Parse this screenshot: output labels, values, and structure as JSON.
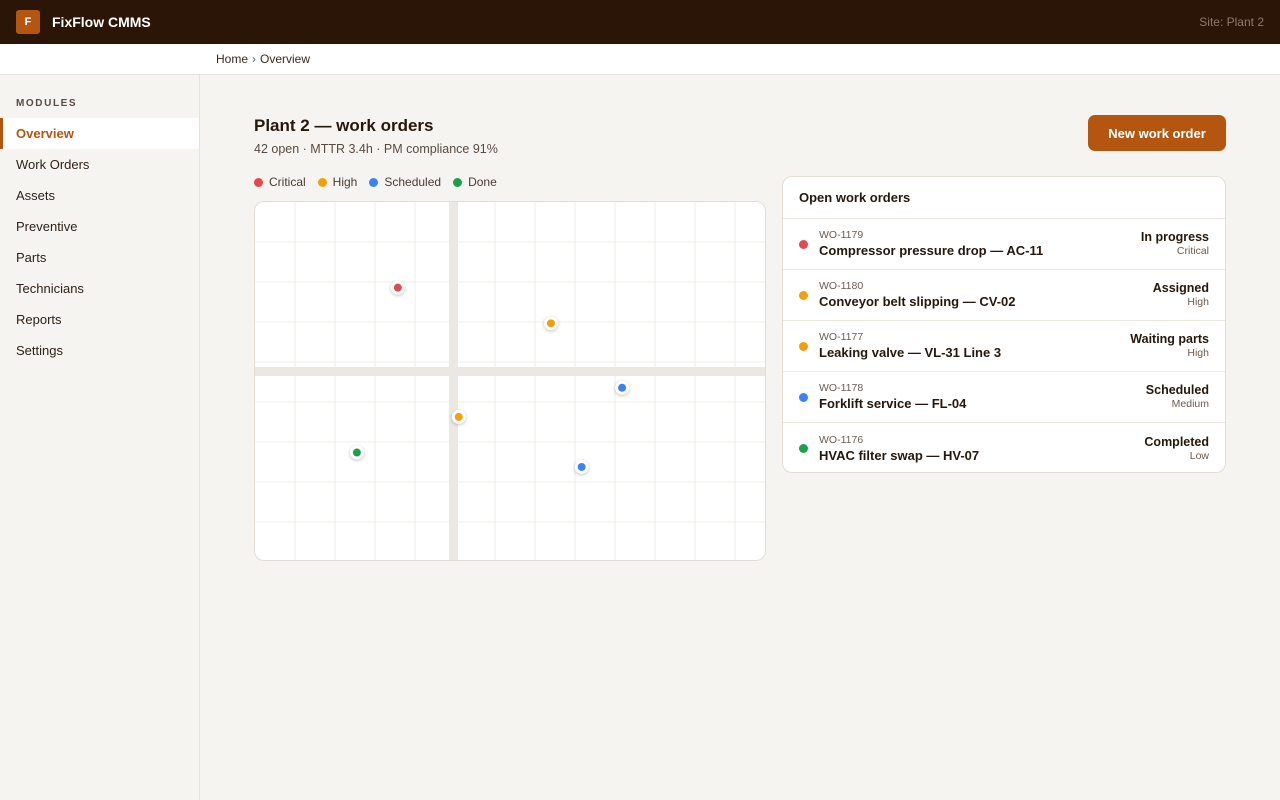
{
  "app": {
    "logo_letter": "F",
    "name": "FixFlow CMMS",
    "site": "Site: Plant 2"
  },
  "breadcrumb": {
    "home": "Home",
    "separator": "›",
    "current": "Overview"
  },
  "sidebar": {
    "heading": "MODULES",
    "items": [
      {
        "label": "Overview",
        "active": true
      },
      {
        "label": "Work Orders"
      },
      {
        "label": "Assets"
      },
      {
        "label": "Preventive"
      },
      {
        "label": "Parts"
      },
      {
        "label": "Technicians"
      },
      {
        "label": "Reports"
      },
      {
        "label": "Settings"
      }
    ]
  },
  "page": {
    "title": "Plant 2 — work orders",
    "subtitle": "42 open · MTTR 3.4h · PM compliance 91%",
    "new_button": "New work order"
  },
  "legend": [
    {
      "label": "Critical",
      "color": "#e5484d"
    },
    {
      "label": "High",
      "color": "#f59e0b"
    },
    {
      "label": "Scheduled",
      "color": "#3b82f6"
    },
    {
      "label": "Done",
      "color": "#16a34a"
    }
  ],
  "map": {
    "markers": [
      {
        "category": "Critical",
        "color": "#e5484d",
        "fx": 0.279,
        "fy": 0.238
      },
      {
        "category": "High",
        "color": "#f59e0b",
        "fx": 0.578,
        "fy": 0.337
      },
      {
        "category": "Scheduled",
        "color": "#3b82f6",
        "fx": 0.717,
        "fy": 0.516
      },
      {
        "category": "High",
        "color": "#f59e0b",
        "fx": 0.398,
        "fy": 0.597
      },
      {
        "category": "Done",
        "color": "#16a34a",
        "fx": 0.199,
        "fy": 0.696
      },
      {
        "category": "Scheduled",
        "color": "#3b82f6",
        "fx": 0.638,
        "fy": 0.736
      }
    ]
  },
  "work_orders": {
    "heading": "Open work orders",
    "rows": [
      {
        "id": "WO-1179",
        "title": "Compressor pressure drop — AC-11",
        "status": "In progress",
        "priority": "Critical",
        "color": "#e5484d"
      },
      {
        "id": "WO-1180",
        "title": "Conveyor belt slipping — CV-02",
        "status": "Assigned",
        "priority": "High",
        "color": "#f59e0b"
      },
      {
        "id": "WO-1177",
        "title": "Leaking valve — VL-31 Line 3",
        "status": "Waiting parts",
        "priority": "High",
        "color": "#f59e0b"
      },
      {
        "id": "WO-1178",
        "title": "Forklift service — FL-04",
        "status": "Scheduled",
        "priority": "Medium",
        "color": "#3b82f6"
      },
      {
        "id": "WO-1176",
        "title": "HVAC filter swap — HV-07",
        "status": "Completed",
        "priority": "Low",
        "color": "#16a34a"
      }
    ]
  }
}
